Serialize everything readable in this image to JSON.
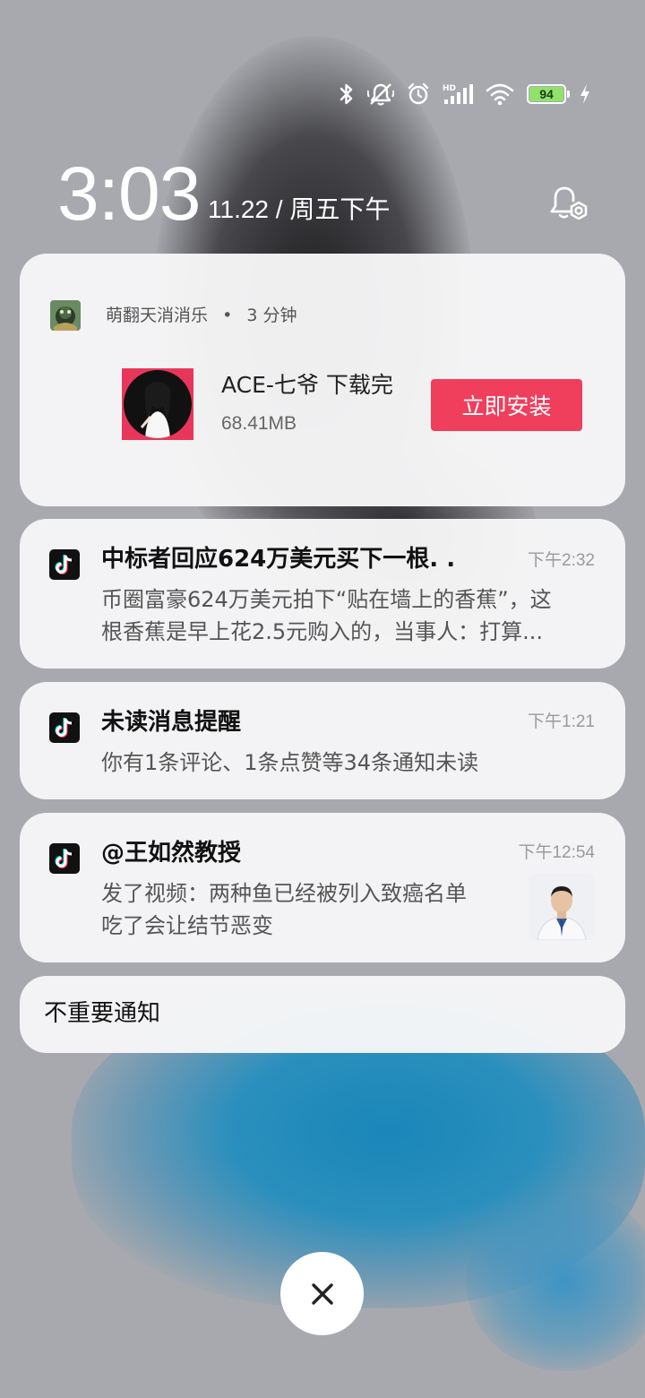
{
  "status_bar": {
    "battery_level": "94",
    "icons": [
      "bluetooth-icon",
      "mute-icon",
      "alarm-icon",
      "hd-signal-icon",
      "wifi-icon",
      "battery-icon",
      "charging-icon"
    ]
  },
  "clock": {
    "time": "3:03",
    "date": "11.22 / 周五下午"
  },
  "notifications": {
    "download": {
      "app_name": "萌翻天消消乐",
      "separator": "•",
      "ago": "3 分钟",
      "title": "ACE-七爷  下载完",
      "size": "68.41MB",
      "button_label": "立即安装",
      "button_color": "#f03e5d"
    },
    "news": {
      "title": "中标者回应624万美元买下一根. .",
      "time": "下午2:32",
      "body_line1": "币圈富豪624万美元拍下“贴在墙上的香蕉”，这",
      "body_line2": "根香蕉是早上花2.5元购入的，当事人：打算..."
    },
    "unread": {
      "title": "未读消息提醒",
      "time": "下午1:21",
      "body": "你有1条评论、1条点赞等34条通知未读"
    },
    "video": {
      "title": "@王如然教授",
      "time": "下午12:54",
      "body_line1": "发了视频：两种鱼已经被列入致癌名单",
      "body_line2": "吃了会让结节恶变"
    },
    "unimportant": {
      "label": "不重要通知"
    }
  }
}
